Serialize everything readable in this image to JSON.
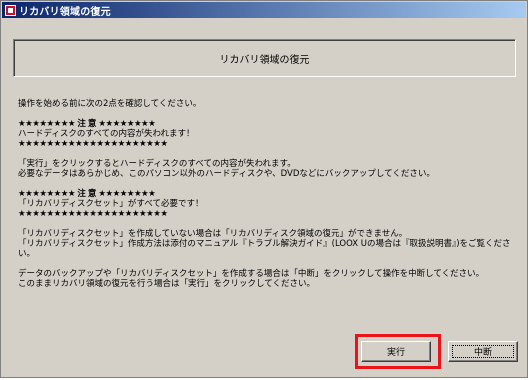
{
  "window": {
    "title": "リカバリ領域の復元"
  },
  "header": {
    "title": "リカバリ領域の復元"
  },
  "content": {
    "lines": [
      "操作を始める前に次の2点を確認してください。",
      "",
      "★★★★★★★★  注 意  ★★★★★★★★",
      "  ハードディスクのすべての内容が失われます！",
      "★★★★★★★★★★★★★★★★★★★★★",
      "",
      "「実行」をクリックするとハードディスクのすべての内容が失われます。",
      "必要なデータはあらかじめ、このパソコン以外のハードディスクや、DVDなどにバックアップしてください。",
      "",
      "★★★★★★★★  注 意  ★★★★★★★★",
      "  「リカバリディスクセット」がすべて必要です！",
      "★★★★★★★★★★★★★★★★★★★★★",
      "",
      "「リカバリディスクセット」を作成していない場合は「リカバリディスク領域の復元」ができません。",
      "「リカバリディスクセット」作成方法は添付のマニュアル『トラブル解決ガイド』(LOOX Uの場合は『取扱説明書』)をご覧くださ",
      "い。",
      "",
      "データのバックアップや「リカバリディスクセット」を作成する場合は「中断」をクリックして操作を中断してください。",
      "このままリカバリ領域の復元を行う場合は「実行」をクリックしてください。"
    ]
  },
  "buttons": {
    "run": "実行",
    "stop": "中断"
  },
  "colors": {
    "title_bar": "#0a246a",
    "highlight": "#e8141a",
    "face": "#d4d0c8"
  }
}
